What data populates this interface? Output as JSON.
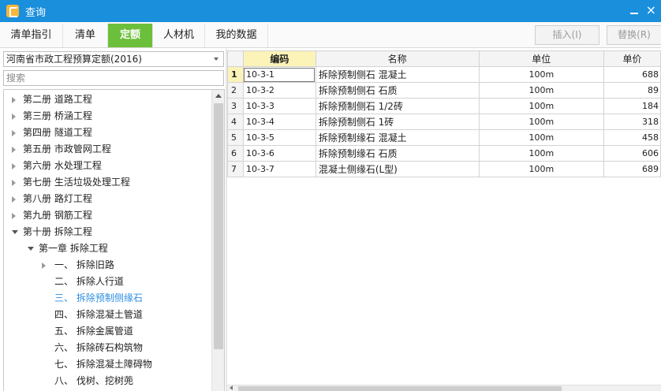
{
  "window": {
    "title": "查询"
  },
  "tabs": [
    {
      "label": "清单指引",
      "active": false
    },
    {
      "label": "清单",
      "active": false
    },
    {
      "label": "定额",
      "active": true
    },
    {
      "label": "人材机",
      "active": false
    },
    {
      "label": "我的数据",
      "active": false
    }
  ],
  "toolbar": {
    "insert_label": "插入(I)",
    "replace_label": "替换(R)"
  },
  "left_panel": {
    "quota_library": "河南省市政工程预算定额(2016)",
    "search_placeholder": "搜索",
    "tree": [
      {
        "label": "第二册  道路工程",
        "level": 0,
        "state": "collapsed"
      },
      {
        "label": "第三册  桥涵工程",
        "level": 0,
        "state": "collapsed"
      },
      {
        "label": "第四册  隧道工程",
        "level": 0,
        "state": "collapsed"
      },
      {
        "label": "第五册  市政管网工程",
        "level": 0,
        "state": "collapsed"
      },
      {
        "label": "第六册  水处理工程",
        "level": 0,
        "state": "collapsed"
      },
      {
        "label": "第七册  生活垃圾处理工程",
        "level": 0,
        "state": "collapsed"
      },
      {
        "label": "第八册  路灯工程",
        "level": 0,
        "state": "collapsed"
      },
      {
        "label": "第九册  钢筋工程",
        "level": 0,
        "state": "collapsed"
      },
      {
        "label": "第十册  拆除工程",
        "level": 0,
        "state": "expanded"
      },
      {
        "label": "第一章  拆除工程",
        "level": 1,
        "state": "expanded"
      },
      {
        "label": "一、  拆除旧路",
        "level": 2,
        "state": "collapsed"
      },
      {
        "label": "二、  拆除人行道",
        "level": 2,
        "state": "leaf"
      },
      {
        "label": "三、  拆除预制侧缘石",
        "level": 2,
        "state": "leaf",
        "selected": true
      },
      {
        "label": "四、  拆除混凝土管道",
        "level": 2,
        "state": "leaf"
      },
      {
        "label": "五、  拆除金属管道",
        "level": 2,
        "state": "leaf"
      },
      {
        "label": "六、  拆除砖石构筑物",
        "level": 2,
        "state": "leaf"
      },
      {
        "label": "七、  拆除混凝土障碍物",
        "level": 2,
        "state": "leaf"
      },
      {
        "label": "八、  伐树、挖树蔸",
        "level": 2,
        "state": "leaf"
      }
    ]
  },
  "grid": {
    "columns": [
      "编码",
      "名称",
      "单位",
      "单价"
    ],
    "rows": [
      {
        "no": "1",
        "code": "10-3-1",
        "name": "拆除预制侧石  混凝土",
        "unit": "100m",
        "price": "688"
      },
      {
        "no": "2",
        "code": "10-3-2",
        "name": "拆除预制侧石  石质",
        "unit": "100m",
        "price": "89"
      },
      {
        "no": "3",
        "code": "10-3-3",
        "name": "拆除预制侧石  1/2砖",
        "unit": "100m",
        "price": "184"
      },
      {
        "no": "4",
        "code": "10-3-4",
        "name": "拆除预制侧石  1砖",
        "unit": "100m",
        "price": "318"
      },
      {
        "no": "5",
        "code": "10-3-5",
        "name": "拆除预制缘石  混凝土",
        "unit": "100m",
        "price": "458"
      },
      {
        "no": "6",
        "code": "10-3-6",
        "name": "拆除预制缘石  石质",
        "unit": "100m",
        "price": "606"
      },
      {
        "no": "7",
        "code": "10-3-7",
        "name": "混凝土侧缘石(L型)",
        "unit": "100m",
        "price": "689"
      }
    ]
  }
}
